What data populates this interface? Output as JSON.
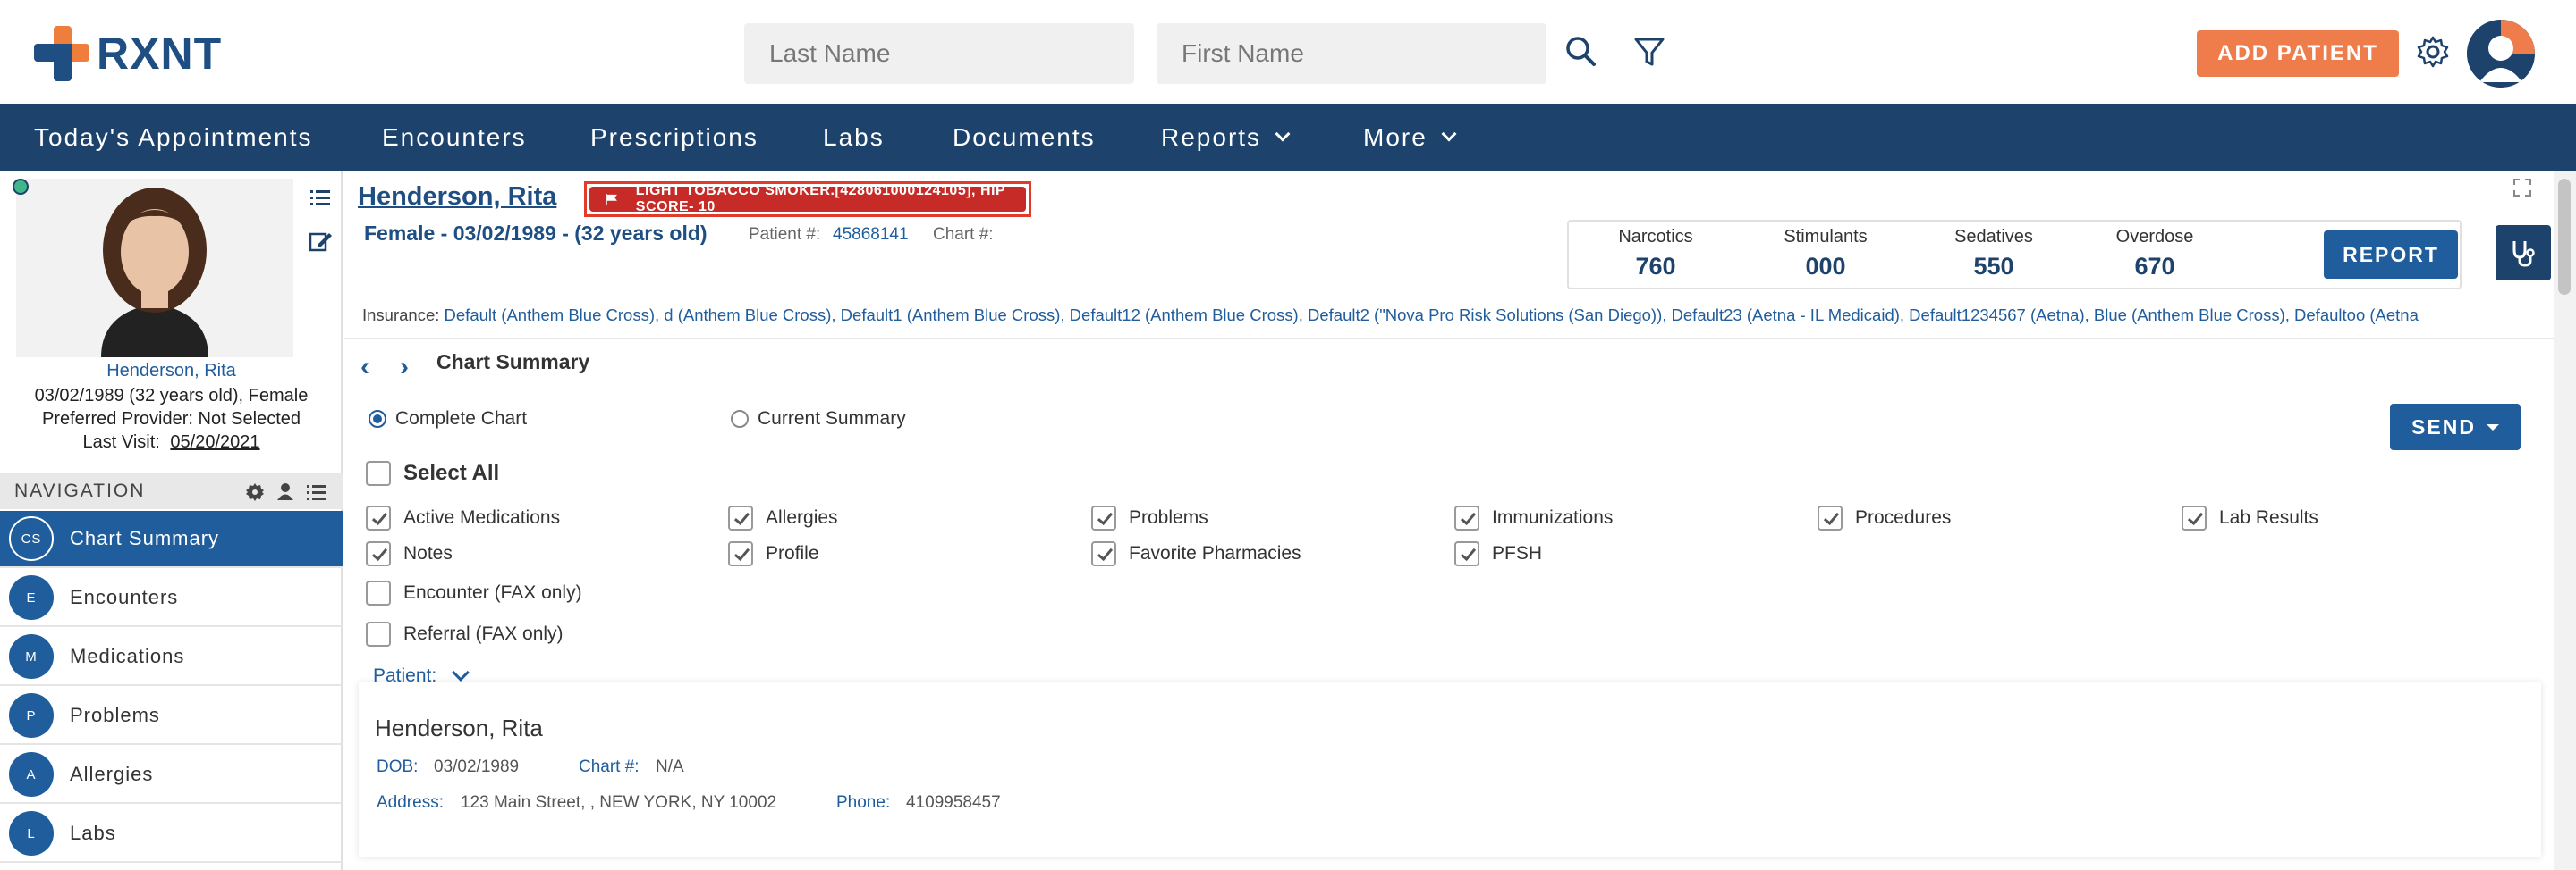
{
  "header": {
    "logo_text": "RXNT",
    "last_name_placeholder": "Last Name",
    "first_name_placeholder": "First Name",
    "add_patient_label": "ADD PATIENT"
  },
  "nav": {
    "items": [
      {
        "label": "Today's Appointments"
      },
      {
        "label": "Encounters"
      },
      {
        "label": "Prescriptions"
      },
      {
        "label": "Labs"
      },
      {
        "label": "Documents"
      },
      {
        "label": "Reports"
      },
      {
        "label": "More"
      }
    ]
  },
  "sidebar": {
    "patient_name": "Henderson, Rita",
    "dob_line": "03/02/1989 (32 years old), Female",
    "provider_line": "Preferred Provider: Not Selected",
    "last_visit_label": "Last Visit:",
    "last_visit_value": "05/20/2021",
    "nav_header": "NAVIGATION",
    "items": [
      {
        "badge": "CS",
        "label": "Chart Summary"
      },
      {
        "badge": "E",
        "label": "Encounters"
      },
      {
        "badge": "M",
        "label": "Medications"
      },
      {
        "badge": "P",
        "label": "Problems"
      },
      {
        "badge": "A",
        "label": "Allergies"
      },
      {
        "badge": "L",
        "label": "Labs"
      }
    ]
  },
  "patient": {
    "name": "Henderson, Rita",
    "alert": "LIGHT TOBACCO SMOKER.[428061000124105], HIP SCORE- 10",
    "demographics": "Female - 03/02/1989 - (32 years old)",
    "patient_num_label": "Patient #:",
    "patient_num": "45868141",
    "chart_num_label": "Chart #:",
    "insurance_label": "Insurance:",
    "insurance": "Default (Anthem Blue Cross), d (Anthem Blue Cross), Default1 (Anthem Blue Cross), Default12 (Anthem Blue Cross), Default2 (\"Nova Pro Risk Solutions (San Diego)), Default23 (Aetna - IL Medicaid), Default1234567 (Aetna), Blue (Anthem Blue Cross), Defaultoo (Aetna"
  },
  "rx": {
    "narcotics_label": "Narcotics",
    "narcotics": "760",
    "stimulants_label": "Stimulants",
    "stimulants": "000",
    "sedatives_label": "Sedatives",
    "sedatives": "550",
    "overdose_label": "Overdose",
    "overdose": "670",
    "report_label": "REPORT"
  },
  "summary": {
    "title": "Chart Summary",
    "complete_chart": "Complete Chart",
    "current_summary": "Current Summary",
    "send_label": "SEND",
    "select_all": "Select All",
    "checkboxes": [
      {
        "label": "Active Medications",
        "checked": true
      },
      {
        "label": "Allergies",
        "checked": true
      },
      {
        "label": "Problems",
        "checked": true
      },
      {
        "label": "Immunizations",
        "checked": true
      },
      {
        "label": "Procedures",
        "checked": true
      },
      {
        "label": "Lab Results",
        "checked": true
      },
      {
        "label": "Notes",
        "checked": true
      },
      {
        "label": "Profile",
        "checked": true
      },
      {
        "label": "Favorite Pharmacies",
        "checked": true
      },
      {
        "label": "PFSH",
        "checked": true
      },
      {
        "label": "Encounter (FAX only)",
        "checked": false
      },
      {
        "label": "Referral (FAX only)",
        "checked": false
      }
    ],
    "patient_toggle": "Patient:"
  },
  "card": {
    "name": "Henderson, Rita",
    "dob_label": "DOB:",
    "dob": "03/02/1989",
    "chart_label": "Chart #:",
    "chart": "N/A",
    "address_label": "Address:",
    "address": "123 Main Street, , NEW YORK, NY 10002",
    "phone_label": "Phone:",
    "phone": "4109958457"
  },
  "colors": {
    "brand_navy": "#1d426b",
    "brand_blue": "#1f5d9c",
    "brand_orange": "#ef7d4b",
    "alert_red": "#c62b27"
  }
}
